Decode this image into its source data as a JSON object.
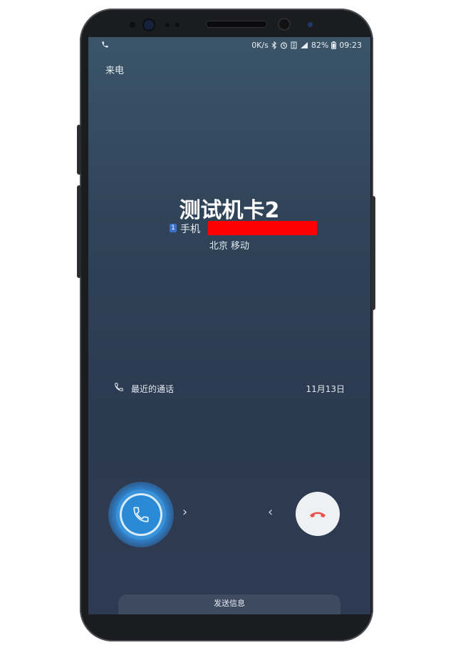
{
  "status_bar": {
    "speed": "0K/s",
    "battery": "82%",
    "time": "09:23"
  },
  "screen": {
    "header_label": "来电",
    "caller_name": "测试机卡2",
    "sim_slot": "1",
    "number_label": "手机",
    "location": "北京 移动",
    "recent_calls": {
      "label": "最近的通话",
      "date": "11月13日"
    },
    "swipe_hint_right": "›",
    "swipe_hint_left": "‹",
    "send_message_label": "发送信息"
  },
  "colors": {
    "accept": "#2a8ad6",
    "decline": "#e5534b",
    "redaction": "#ff0000"
  },
  "icons": {
    "accept": "phone-icon",
    "decline": "phone-hangup-icon",
    "recent": "phone-icon"
  }
}
